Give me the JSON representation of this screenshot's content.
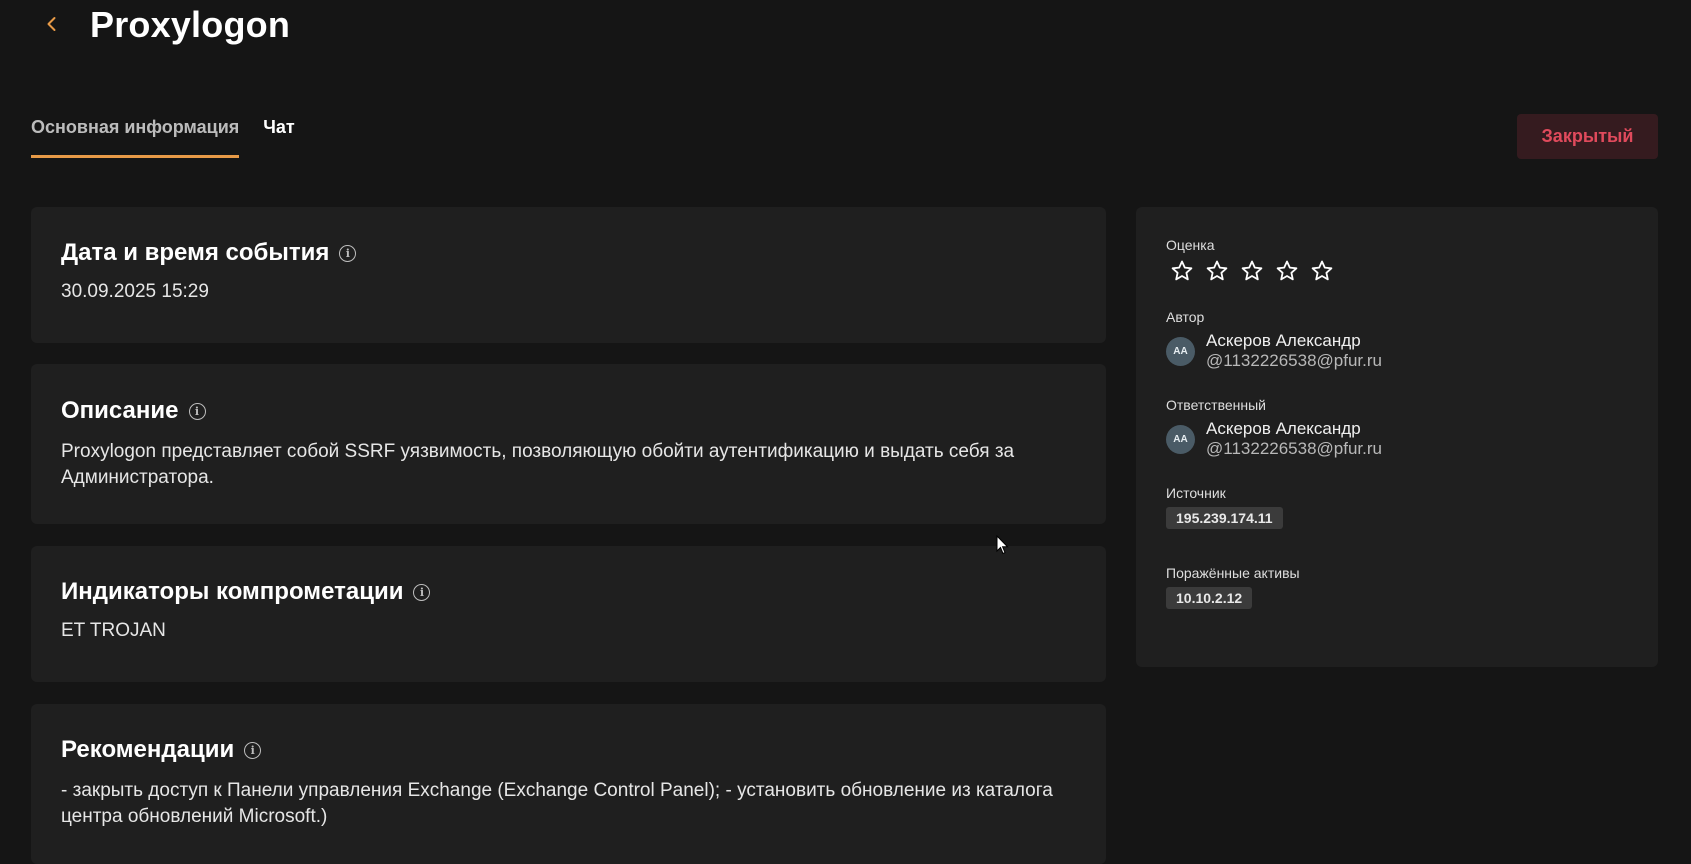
{
  "header": {
    "title": "Proxylogon"
  },
  "tabs": [
    {
      "label": "Основная информация",
      "active": true
    },
    {
      "label": "Чат",
      "active": false
    }
  ],
  "status": {
    "label": "Закрытый",
    "color": "#e04a5c"
  },
  "cards": {
    "date": {
      "title": "Дата и время события",
      "value": "30.09.2025 15:29"
    },
    "description": {
      "title": "Описание",
      "value": "Proxylogon представляет собой SSRF уязвимость, позволяющую обойти аутентификацию и выдать себя за Администратора."
    },
    "ioc": {
      "title": "Индикаторы компрометации",
      "value": "ET TROJAN"
    },
    "recommendations": {
      "title": "Рекомендации",
      "value": "- закрыть доступ к Панели управления Exchange (Exchange Control Panel); - установить обновление из каталога центра обновлений Microsoft.)"
    }
  },
  "side": {
    "rating": {
      "label": "Оценка",
      "value": 0,
      "max": 5
    },
    "author": {
      "label": "Автор",
      "initials": "АА",
      "name": "Аскеров Александр",
      "email": "@1132226538@pfur.ru"
    },
    "responsible": {
      "label": "Ответственный",
      "initials": "АА",
      "name": "Аскеров Александр",
      "email": "@1132226538@pfur.ru"
    },
    "source": {
      "label": "Источник",
      "value": "195.239.174.11"
    },
    "assets": {
      "label": "Поражённые активы",
      "value": "10.10.2.12"
    }
  },
  "colors": {
    "background": "#151515",
    "card": "#1f1f1f",
    "accent": "#e79a47"
  }
}
